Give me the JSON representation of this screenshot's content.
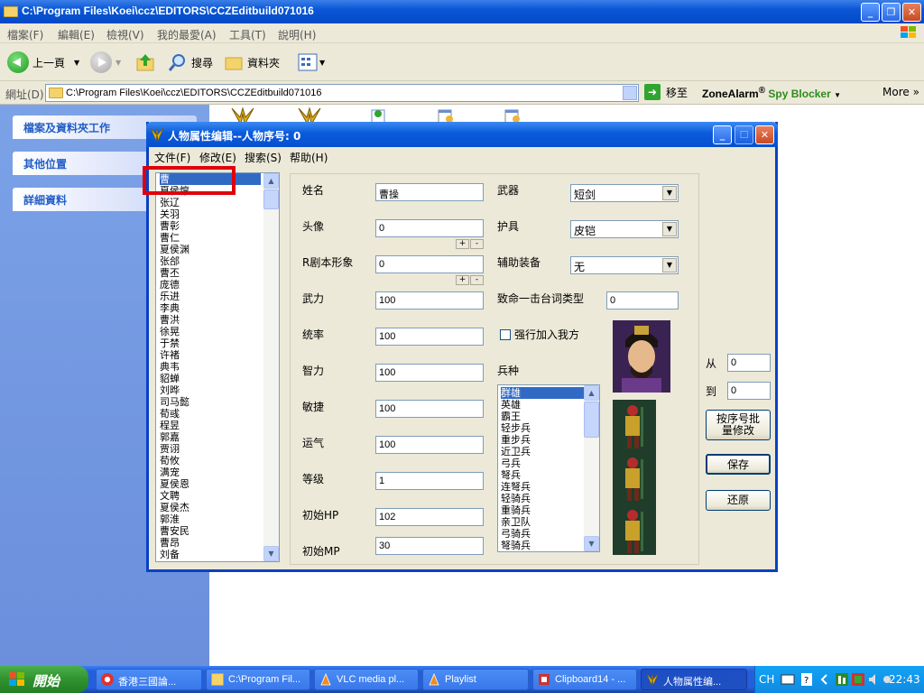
{
  "explorer": {
    "title": "C:\\Program Files\\Koei\\ccz\\EDITORS\\CCZEditbuild071016",
    "menu": [
      "檔案(F)",
      "編輯(E)",
      "檢視(V)",
      "我的最愛(A)",
      "工具(T)",
      "說明(H)"
    ],
    "toolbar": {
      "back": "上一頁",
      "search": "搜尋",
      "folders": "資料夾"
    },
    "address_label": "網址(D)",
    "address_value": "C:\\Program Files\\Koei\\ccz\\EDITORS\\CCZEditbuild071016",
    "go_label": "移至",
    "zonealarm": {
      "brand": "ZoneAlarm",
      "reg": "®",
      "product": "Spy Blocker"
    },
    "more_label": "More",
    "tasks": [
      "檔案及資料夾工作",
      "其他位置",
      "詳細資料"
    ]
  },
  "dialog": {
    "title": "人物属性编辑--人物序号: 0",
    "menu": [
      "文件(F)",
      "修改(E)",
      "搜索(S)",
      "帮助(H)"
    ],
    "character_list": [
      "曹",
      "夏侯惇",
      "张辽",
      "关羽",
      "曹彰",
      "曹仁",
      "夏侯渊",
      "张郃",
      "曹丕",
      "庞德",
      "乐进",
      "李典",
      "曹洪",
      "徐晃",
      "于禁",
      "许褚",
      "典韦",
      "貂蝉",
      "刘晔",
      "司马懿",
      "荀彧",
      "程昱",
      "郭嘉",
      "贾诩",
      "荀攸",
      "满宠",
      "夏侯恩",
      "文聘",
      "夏侯杰",
      "郭淮",
      "曹安民",
      "曹昂",
      "刘备"
    ],
    "fields": {
      "name": {
        "label": "姓名",
        "value": "曹操"
      },
      "head": {
        "label": "头像",
        "value": "0"
      },
      "rscript": {
        "label": "R剧本形象",
        "value": "0"
      },
      "force": {
        "label": "武力",
        "value": "100"
      },
      "command": {
        "label": "统率",
        "value": "100"
      },
      "intellect": {
        "label": "智力",
        "value": "100"
      },
      "agility": {
        "label": "敏捷",
        "value": "100"
      },
      "luck": {
        "label": "运气",
        "value": "100"
      },
      "level": {
        "label": "等级",
        "value": "1"
      },
      "init_hp": {
        "label": "初始HP",
        "value": "102"
      },
      "init_mp": {
        "label": "初始MP",
        "value": "30"
      }
    },
    "plus": "+",
    "minus": "-",
    "weapon": {
      "label": "武器",
      "value": "短剑"
    },
    "armor": {
      "label": "护具",
      "value": "皮铠"
    },
    "accessory": {
      "label": "辅助装备",
      "value": "无"
    },
    "fatal_line": {
      "label": "致命一击台词类型",
      "value": "0"
    },
    "force_join": "强行加入我方",
    "troop_label": "兵种",
    "troops": [
      "群雄",
      "英雄",
      "霸王",
      "轻步兵",
      "重步兵",
      "近卫兵",
      "弓兵",
      "弩兵",
      "连弩兵",
      "轻骑兵",
      "重骑兵",
      "亲卫队",
      "弓骑兵",
      "弩骑兵"
    ],
    "from_label": "从",
    "from_value": "0",
    "to_label": "到",
    "to_value": "0",
    "batch_button": "按序号批量修改",
    "save_button": "保存",
    "restore_button": "还原"
  },
  "taskbar": {
    "start": "開始",
    "tasks": [
      "香港三國論...",
      "C:\\Program Fil...",
      "VLC media pl...",
      "Playlist",
      "Clipboard14 - ...",
      "人物属性编..."
    ],
    "lang": "CH",
    "clock": "22:43"
  }
}
